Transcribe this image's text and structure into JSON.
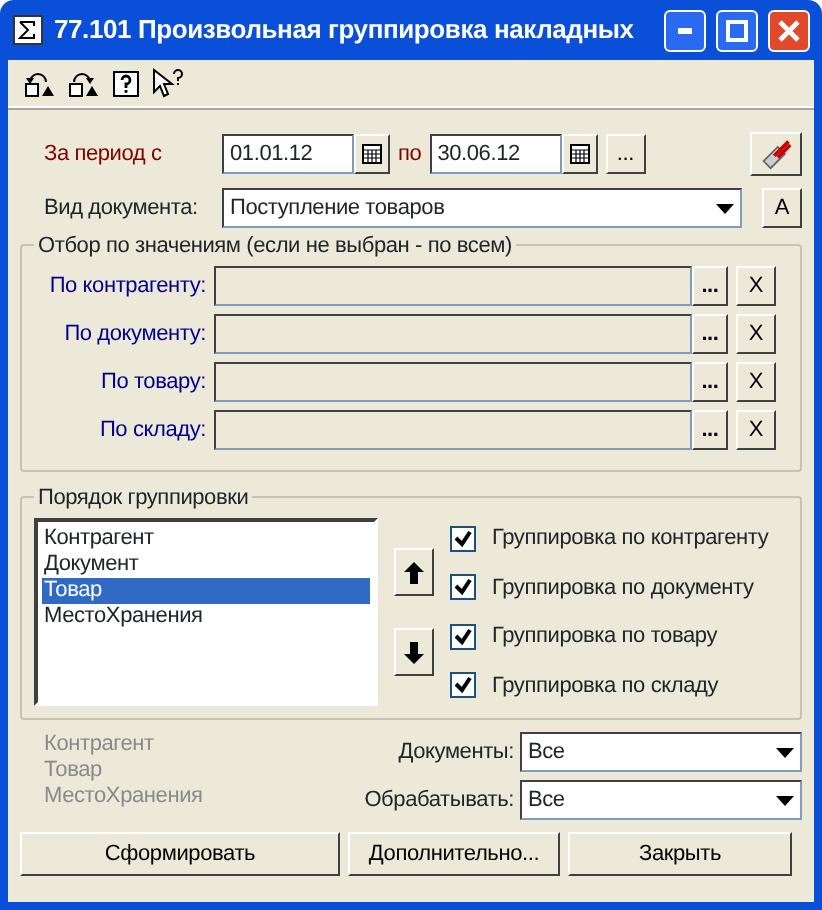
{
  "window": {
    "title": "77.101 Произвольная группировка накладных"
  },
  "period": {
    "label": "За период с",
    "from": "01.01.12",
    "to_label": "по",
    "to": "30.06.12",
    "more_button": "..."
  },
  "doc_type": {
    "label": "Вид документа:",
    "value": "Поступление товаров",
    "button": "А"
  },
  "filter": {
    "title": "Отбор по значениям (если не выбран - по всем)",
    "rows": [
      {
        "label": "По контрагенту:",
        "select_button": "...",
        "clear_button": "X"
      },
      {
        "label": "По документу:",
        "select_button": "...",
        "clear_button": "X"
      },
      {
        "label": "По товару:",
        "select_button": "...",
        "clear_button": "X"
      },
      {
        "label": "По складу:",
        "select_button": "...",
        "clear_button": "X"
      }
    ]
  },
  "grouping": {
    "title": "Порядок группировки",
    "items": [
      {
        "label": "Контрагент",
        "selected": false
      },
      {
        "label": "Документ",
        "selected": false
      },
      {
        "label": "Товар",
        "selected": true
      },
      {
        "label": "МестоХранения",
        "selected": false
      }
    ],
    "checks": [
      {
        "label": "Группировка по контрагенту",
        "checked": true
      },
      {
        "label": "Группировка по документу",
        "checked": true
      },
      {
        "label": "Группировка по товару",
        "checked": true
      },
      {
        "label": "Группировка по складу",
        "checked": true
      }
    ]
  },
  "summary": [
    "Контрагент",
    "Товар",
    "МестоХранения"
  ],
  "selects": [
    {
      "label": "Документы:",
      "value": "Все"
    },
    {
      "label": "Обрабатывать:",
      "value": "Все"
    }
  ],
  "buttons": [
    "Сформировать",
    "Дополнительно...",
    "Закрыть"
  ]
}
